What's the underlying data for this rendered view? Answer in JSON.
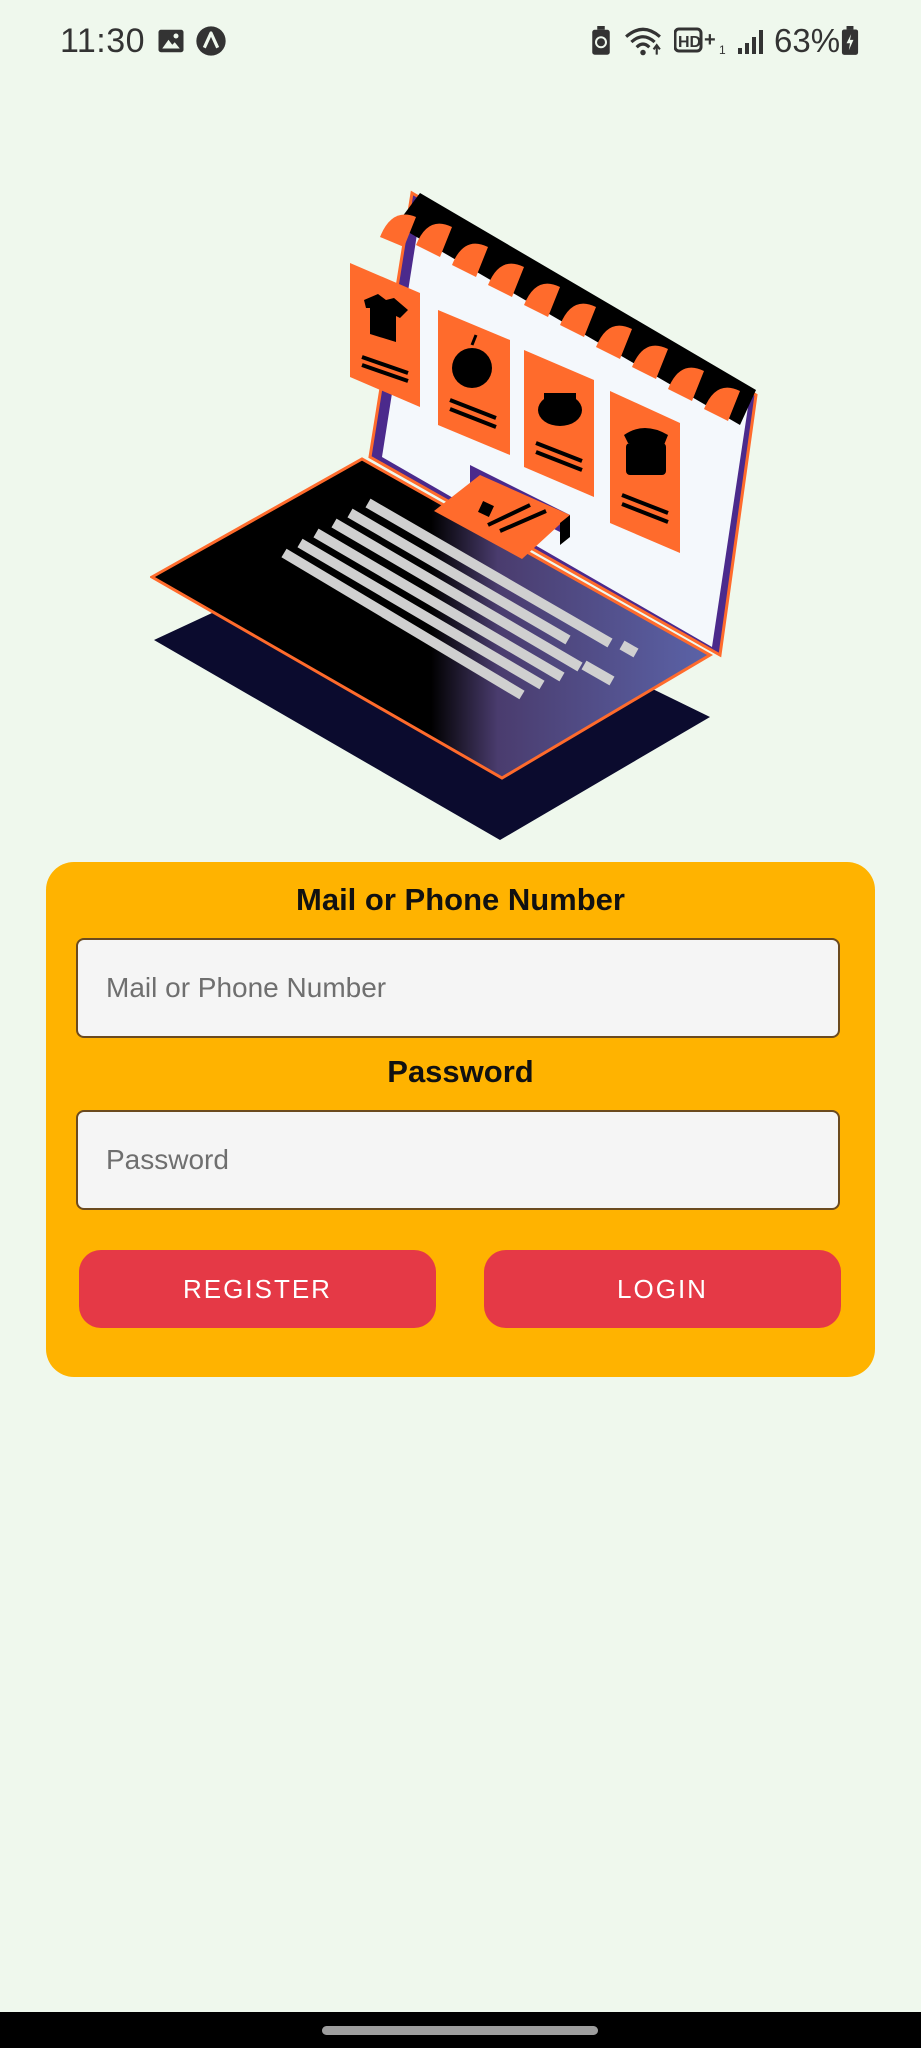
{
  "status_bar": {
    "time": "11:30",
    "battery_percent": "63%",
    "icons": [
      "gallery-icon",
      "app-icon",
      "battery-saver-icon",
      "wifi-icon",
      "hd-plus-icon",
      "signal-icon",
      "battery-icon"
    ]
  },
  "illustration": {
    "name": "laptop-online-shop-illustration"
  },
  "login_form": {
    "mail_label": "Mail or Phone Number",
    "mail_placeholder": "Mail or Phone Number",
    "mail_value": "",
    "password_label": "Password",
    "password_placeholder": "Password",
    "password_value": "",
    "register_label": "REGISTER",
    "login_label": "LOGIN"
  },
  "colors": {
    "background": "#eff8ed",
    "card": "#ffb300",
    "button": "#e53946",
    "accent_orange": "#ff6b2c"
  }
}
